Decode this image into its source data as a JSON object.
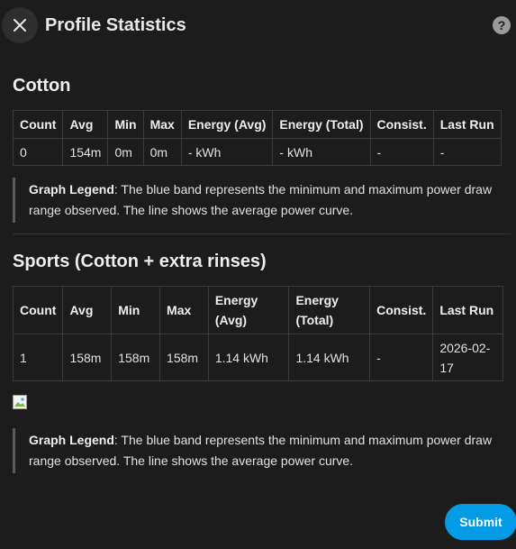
{
  "dialog": {
    "title": "Profile Statistics",
    "close_icon": "close-icon",
    "help_icon": "help-icon",
    "help_glyph": "?"
  },
  "headers": {
    "count": "Count",
    "avg": "Avg",
    "min": "Min",
    "max": "Max",
    "energy_avg": "Energy (Avg)",
    "energy_total": "Energy (Total)",
    "consist": "Consist.",
    "last_run": "Last Run"
  },
  "profiles": [
    {
      "name": "Cotton",
      "stats": {
        "count": "0",
        "avg": "154m",
        "min": "0m",
        "max": "0m",
        "energy_avg": "- kWh",
        "energy_total": "- kWh",
        "consist": "-",
        "last_run": "-"
      },
      "legend": {
        "label": "Graph Legend",
        "text": ": The blue band represents the minimum and maximum power draw range observed. The line shows the average power curve."
      }
    },
    {
      "name": "Sports (Cotton + extra rinses)",
      "stats": {
        "count": "1",
        "avg": "158m",
        "min": "158m",
        "max": "158m",
        "energy_avg": "1.14 kWh",
        "energy_total": "1.14 kWh",
        "consist": "-",
        "last_run": "2026-02-17"
      },
      "legend": {
        "label": "Graph Legend",
        "text": ": The blue band represents the minimum and maximum power draw range observed. The line shows the average power curve."
      }
    }
  ],
  "actions": {
    "submit_label": "Submit"
  },
  "colors": {
    "background": "#1c1c1c",
    "accent": "#039be5",
    "text": "#e1e1e1"
  }
}
